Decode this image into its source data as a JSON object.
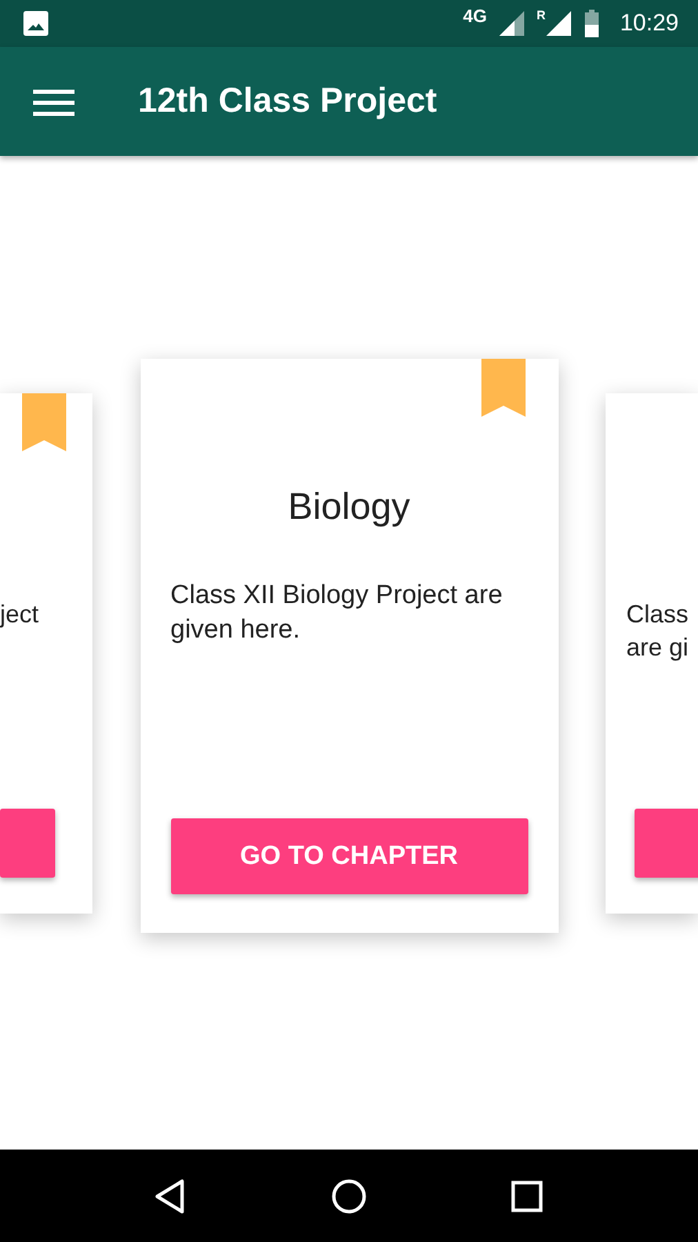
{
  "status_bar": {
    "network": "4G",
    "roaming": "R",
    "time": "10:29"
  },
  "toolbar": {
    "title": "12th Class Project"
  },
  "cards": [
    {
      "kind": "left-peek",
      "bookmarked": true,
      "lines": [
        "ject"
      ]
    },
    {
      "kind": "center",
      "bookmarked": true,
      "title": "Biology",
      "lines": [
        "Class XII Biology Project are",
        "given here."
      ],
      "button": "GO TO CHAPTER"
    },
    {
      "kind": "right-peek",
      "bookmarked": false,
      "lines": [
        "Class",
        "are gi"
      ]
    }
  ]
}
